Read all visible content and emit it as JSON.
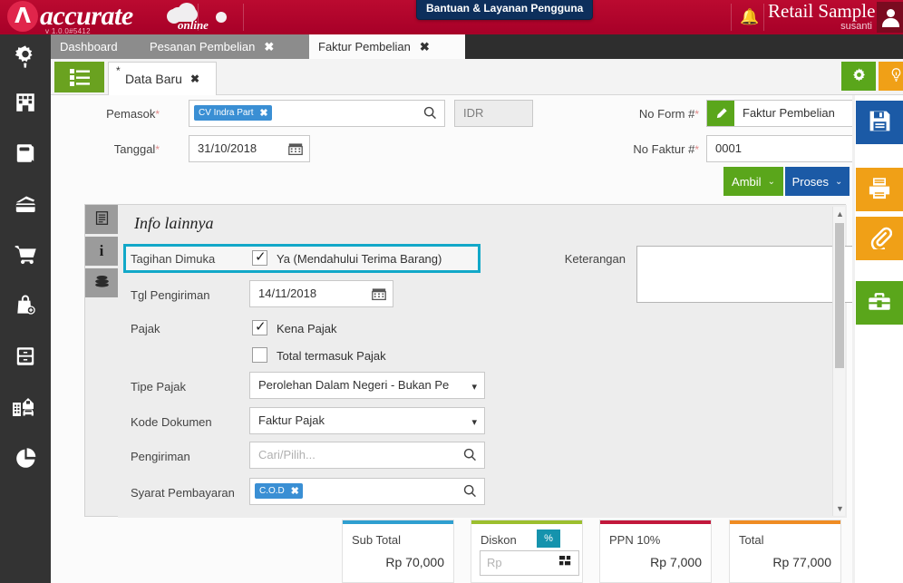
{
  "header": {
    "logo_word": "accurate",
    "logo_online": "online",
    "version": "v 1.0.0#5412",
    "help_pill": "Bantuan & Layanan Pengguna",
    "bell_icon": "bell-icon",
    "company": "Retail Sample",
    "username": "susanti",
    "avatar_icon": "user-avatar-icon"
  },
  "browser_tabs": [
    {
      "label": "Dashboard",
      "active": false,
      "closable": false
    },
    {
      "label": "Pesanan Pembelian",
      "active": false,
      "closable": true,
      "close": "✖"
    },
    {
      "label": "Faktur Pembelian",
      "active": true,
      "closable": true,
      "close": "✖"
    }
  ],
  "left_rail": [
    {
      "name": "sidebar-item-settings",
      "icon": "gear-wrench-icon"
    },
    {
      "name": "sidebar-item-company",
      "icon": "building-icon"
    },
    {
      "name": "sidebar-item-book",
      "icon": "notebook-icon"
    },
    {
      "name": "sidebar-item-wallet",
      "icon": "wallet-icon"
    },
    {
      "name": "sidebar-item-sales",
      "icon": "shopping-cart-icon"
    },
    {
      "name": "sidebar-item-purchase",
      "icon": "shopping-bag-plus-icon"
    },
    {
      "name": "sidebar-item-inventory",
      "icon": "cabinet-icon"
    },
    {
      "name": "sidebar-item-assets",
      "icon": "building-house-car-icon"
    },
    {
      "name": "sidebar-item-reports",
      "icon": "pie-chart-icon"
    }
  ],
  "subbar": {
    "menu_icon": "list-menu-icon",
    "inner_tab_label": "Data Baru",
    "inner_tab_dirty_marker": "*",
    "inner_tab_close": "✖",
    "gear_button_icon": "gear-icon",
    "bulb_button_icon": "lightbulb-icon"
  },
  "form": {
    "pemasok_label": "Pemasok",
    "pemasok_required": "*",
    "pemasok_chip": "CV Indra Part",
    "pemasok_chip_remove": "✖",
    "pemasok_search_icon": "search-icon",
    "currency_value": "IDR",
    "tanggal_label": "Tanggal",
    "tanggal_required": "*",
    "tanggal_value": "31/10/2018",
    "tanggal_calendar_icon": "calendar-icon",
    "no_form_label": "No Form #",
    "no_form_required": "*",
    "no_form_edit_icon": "pencil-icon",
    "no_form_value": "Faktur Pembelian",
    "no_form_caret": "▾",
    "no_faktur_label": "No Faktur #",
    "no_faktur_required": "*",
    "no_faktur_value": "0001",
    "no_faktur_clear": "✖",
    "btn_ambil": "Ambil",
    "btn_ambil_caret": "⌄",
    "btn_proses": "Proses",
    "btn_proses_caret": "⌄"
  },
  "panel": {
    "vtabs": [
      {
        "name": "vtab-detail",
        "icon": "document-lines-icon"
      },
      {
        "name": "vtab-info",
        "icon": "info-i-icon",
        "selected": true
      },
      {
        "name": "vtab-payment",
        "icon": "coins-stack-icon"
      }
    ],
    "title": "Info lainnya",
    "tagihan_label": "Tagihan Dimuka",
    "tagihan_checked": true,
    "tagihan_option": "Ya (Mendahului Terima Barang)",
    "tgl_pengiriman_label": "Tgl Pengiriman",
    "tgl_pengiriman_value": "14/11/2018",
    "tgl_pengiriman_calendar_icon": "calendar-icon",
    "pajak_label": "Pajak",
    "kena_pajak_label": "Kena Pajak",
    "kena_pajak_checked": true,
    "total_termasuk_pajak_label": "Total termasuk Pajak",
    "total_termasuk_pajak_checked": false,
    "tipe_pajak_label": "Tipe Pajak",
    "tipe_pajak_value": "Perolehan Dalam Negeri - Bukan Pe",
    "tipe_pajak_caret": "▾",
    "kode_dokumen_label": "Kode Dokumen",
    "kode_dokumen_value": "Faktur Pajak",
    "kode_dokumen_caret": "▾",
    "pengiriman_label": "Pengiriman",
    "pengiriman_placeholder": "Cari/Pilih...",
    "pengiriman_search_icon": "search-icon",
    "syarat_label": "Syarat Pembayaran",
    "syarat_chip": "C.O.D",
    "syarat_chip_remove": "✖",
    "syarat_search_icon": "search-icon",
    "keterangan_label": "Keterangan",
    "keterangan_value": "",
    "scroll_up": "▲",
    "scroll_down": "▼"
  },
  "totals": [
    {
      "name": "subtotal",
      "title": "Sub Total",
      "value": "Rp 70,000",
      "accent": "#2f9fd0"
    },
    {
      "name": "diskon",
      "title": "Diskon",
      "value": "",
      "accent": "#9cbf2e",
      "badge": "%",
      "input_placeholder": "Rp",
      "calc_icon": "calculator-icon"
    },
    {
      "name": "ppn",
      "title": "PPN 10%",
      "value": "Rp 7,000",
      "accent": "#c2183c"
    },
    {
      "name": "total",
      "title": "Total",
      "value": "Rp 77,000",
      "accent": "#ef8c23"
    }
  ],
  "right_rail": [
    {
      "name": "save-button",
      "icon": "save-floppy-icon",
      "color": "#1b5aa6"
    },
    {
      "name": "print-button",
      "icon": "printer-icon",
      "color": "#f0a017"
    },
    {
      "name": "attachment-button",
      "icon": "paperclip-icon",
      "color": "#f0a017"
    },
    {
      "name": "toolbox-button",
      "icon": "toolbox-icon",
      "color": "#5aa61b"
    }
  ]
}
